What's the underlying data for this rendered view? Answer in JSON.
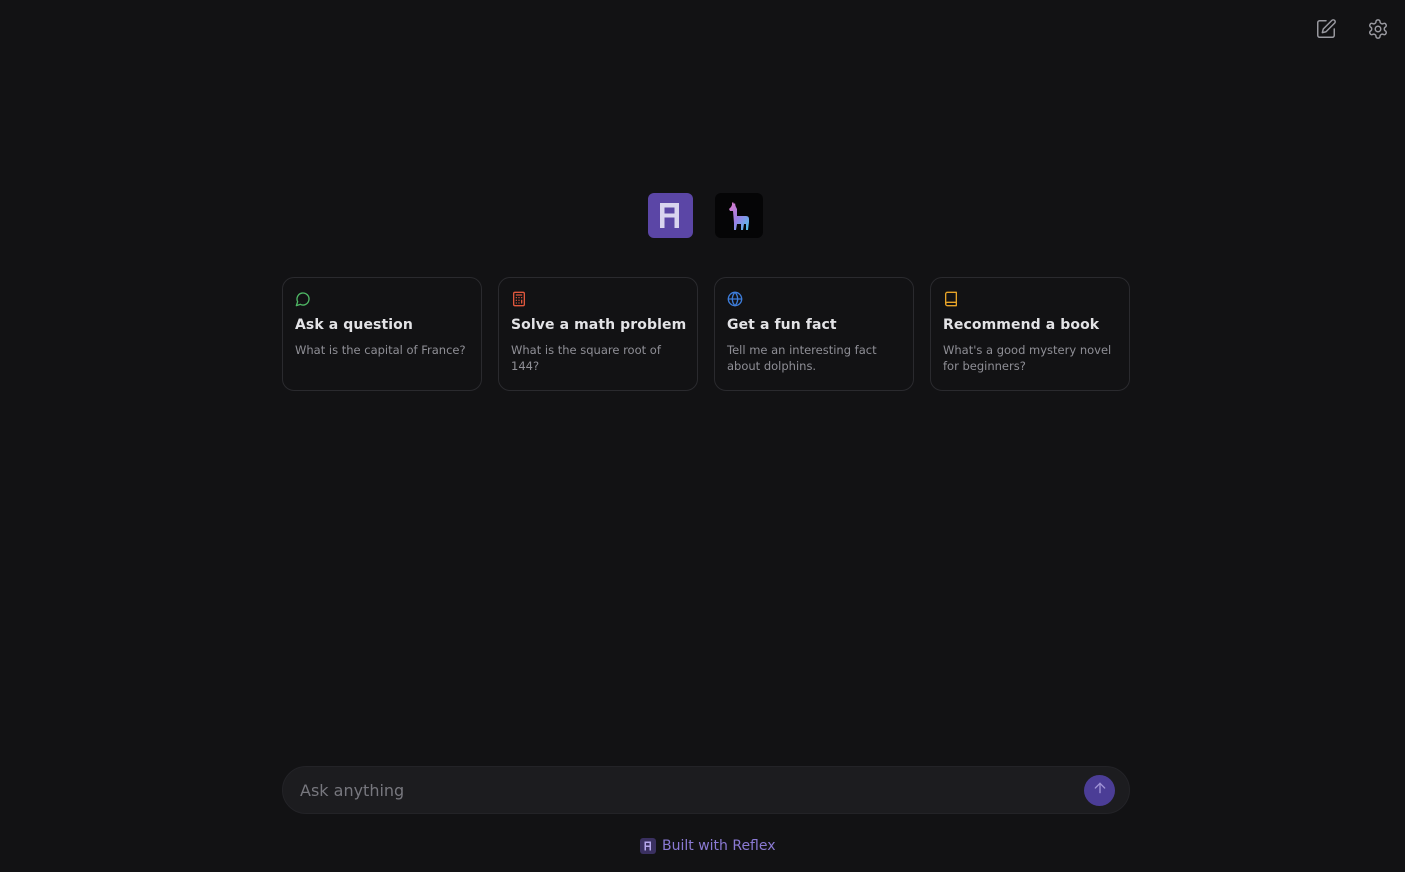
{
  "header": {
    "new_chat_icon": "edit-icon",
    "settings_icon": "gear-icon"
  },
  "logos": {
    "primary": "reflex-logo",
    "secondary": "llama-logo"
  },
  "suggestions": [
    {
      "icon": "message-circle-icon",
      "icon_color": "#4fb865",
      "title": "Ask a question",
      "description": "What is the capital of France?"
    },
    {
      "icon": "calculator-icon",
      "icon_color": "#e0573d",
      "title": "Solve a math problem",
      "description": "What is the square root of 144?"
    },
    {
      "icon": "globe-icon",
      "icon_color": "#3d7ddb",
      "title": "Get a fun fact",
      "description": "Tell me an interesting fact about dolphins."
    },
    {
      "icon": "book-icon",
      "icon_color": "#e6a328",
      "title": "Recommend a book",
      "description": "What's a good mystery novel for beginners?"
    }
  ],
  "composer": {
    "placeholder": "Ask anything",
    "value": "",
    "send_icon": "arrow-up-icon"
  },
  "footer": {
    "text": "Built with Reflex"
  },
  "colors": {
    "background": "#121214",
    "accent": "#5b46a6",
    "send_button": "#4b3d96",
    "footer_text": "#8b7ad4"
  }
}
